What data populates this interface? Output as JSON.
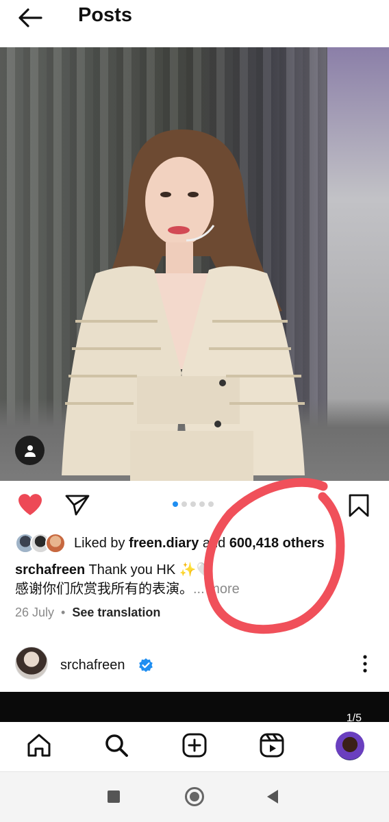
{
  "header": {
    "title": "Posts"
  },
  "post": {
    "carousel": {
      "count": 5,
      "active_index": 0
    },
    "likes": {
      "prefix": "Liked by ",
      "user": "freen.diary",
      "middle": " and ",
      "count": "600,418",
      "suffix": " others"
    },
    "caption": {
      "username": "srchafreen",
      "text": " Thank you HK ✨🤍",
      "line2": "感谢你们欣赏我所有的表演。",
      "more": "... more"
    },
    "date": "26 July",
    "separator": "•",
    "see_translation": "See translation"
  },
  "next_post": {
    "username": "srchafreen",
    "counter": "1/5"
  },
  "colors": {
    "like_red": "#ed4956",
    "dot_active": "#1f8ef1",
    "annotation_red": "#f0505a"
  }
}
